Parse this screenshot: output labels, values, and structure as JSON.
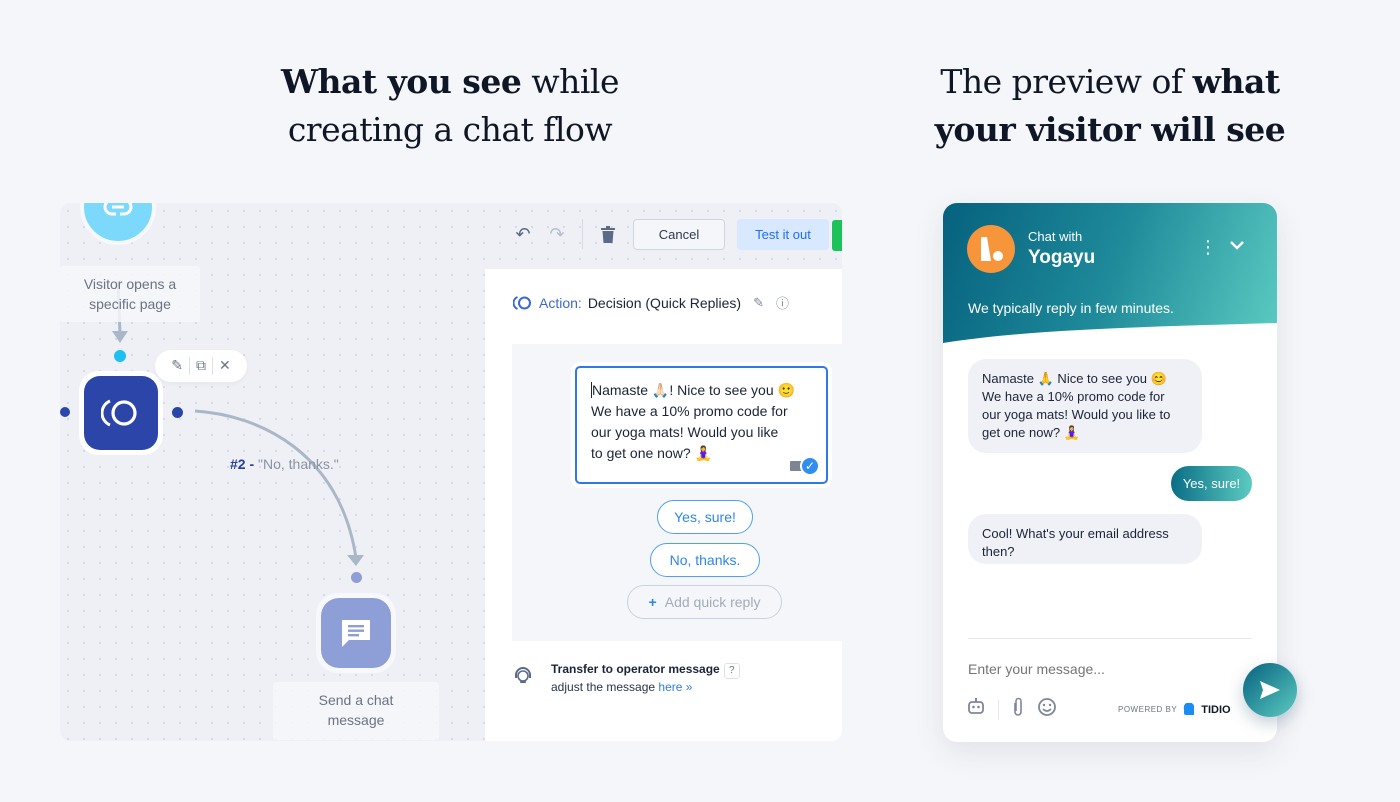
{
  "headings": {
    "left_bold": "What you see",
    "left_rest_line1": " while",
    "left_line2": "creating a chat flow",
    "right_line1": "The preview of ",
    "right_bold1": "what",
    "right_bold2": "your visitor will see"
  },
  "builder": {
    "toolbar": {
      "undo_icon": "undo-icon",
      "redo_icon": "redo-icon",
      "delete_icon": "trash-icon",
      "cancel_label": "Cancel",
      "test_label": "Test it out"
    },
    "nodes": {
      "trigger": {
        "icon": "link-icon",
        "label_line1": "Visitor opens a",
        "label_line2": "specific page",
        "color": "#7dd9fb"
      },
      "action": {
        "icon": "decision-icon",
        "color": "#2b46a8",
        "tools": [
          "edit-icon",
          "duplicate-icon",
          "close-icon"
        ]
      },
      "send": {
        "icon": "chat-message-icon",
        "label_line1": "Send a chat",
        "label_line2": "message",
        "color": "#8e9ed6"
      }
    },
    "edge": {
      "number": "#2 -",
      "text": "\"No, thanks.\""
    },
    "panel": {
      "action_prefix": "Action:",
      "action_value": "Decision (Quick Replies)",
      "message_lines": [
        "Namaste 🙏🏻! Nice to see you 🙂",
        "We have a 10% promo code for",
        "our yoga mats! Would you like",
        "to get one now? 🧘‍♀️"
      ],
      "quick_replies": [
        "Yes, sure!",
        "No, thanks."
      ],
      "add_quick_reply": "Add quick reply",
      "transfer_title": "Transfer to operator message",
      "transfer_help": "?",
      "transfer_text": "adjust the message ",
      "transfer_link": "here »"
    }
  },
  "widget": {
    "chat_with": "Chat with",
    "name": "Yogayu",
    "reply_time": "We typically reply in few minutes.",
    "messages": [
      {
        "from": "bot",
        "lines": [
          "Namaste 🙏 Nice to see you 😊",
          "We have a 10% promo code for",
          "our yoga mats! Would you like to",
          "get one now? 🧘‍♀️"
        ]
      },
      {
        "from": "visitor",
        "text": "Yes, sure!"
      },
      {
        "from": "bot",
        "lines": [
          "Cool! What's your email address",
          "then?"
        ]
      }
    ],
    "input_placeholder": "Enter your message...",
    "powered_by": "POWERED BY",
    "brand": "TIDIO",
    "colors": {
      "header_start": "#06617e",
      "header_end": "#5ccbc1",
      "avatar": "#f7953b"
    }
  }
}
